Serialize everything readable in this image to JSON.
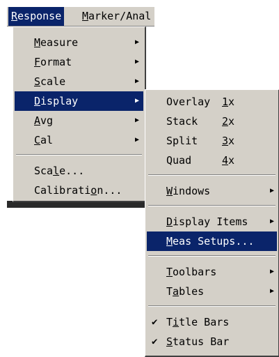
{
  "menubar": {
    "items": [
      {
        "label": "Response",
        "mnemonic": 0,
        "active": true
      },
      {
        "label": "Marker/Anal",
        "mnemonic": 0,
        "active": false
      }
    ]
  },
  "response_menu": {
    "items": [
      {
        "label": "Measure",
        "mnemonic": 0,
        "submenu": true
      },
      {
        "label": "Format",
        "mnemonic": 0,
        "submenu": true
      },
      {
        "label": "Scale",
        "mnemonic": 0,
        "submenu": true
      },
      {
        "label": "Display",
        "mnemonic": 0,
        "submenu": true,
        "highlighted": true
      },
      {
        "label": "Avg",
        "mnemonic": 0,
        "submenu": true
      },
      {
        "label": "Cal",
        "mnemonic": 0,
        "submenu": true
      },
      {
        "separator": true
      },
      {
        "label": "Scale...",
        "mnemonic": 3
      },
      {
        "label": "Calibration...",
        "mnemonic": 9
      }
    ]
  },
  "display_menu": {
    "items": [
      {
        "label": "Overlay",
        "accel": "1x"
      },
      {
        "label": "Stack",
        "accel": "2x"
      },
      {
        "label": "Split",
        "accel": "3x"
      },
      {
        "label": "Quad",
        "accel": "4x"
      },
      {
        "separator": true
      },
      {
        "label": "Windows",
        "mnemonic": 0,
        "submenu": true
      },
      {
        "separator": true
      },
      {
        "label": "Display Items",
        "mnemonic": 0,
        "submenu": true
      },
      {
        "label": "Meas Setups...",
        "mnemonic": 0,
        "highlighted": true
      },
      {
        "separator": true
      },
      {
        "label": "Toolbars",
        "mnemonic": 0,
        "submenu": true
      },
      {
        "label": "Tables",
        "mnemonic": 1,
        "submenu": true
      },
      {
        "separator": true
      },
      {
        "label": "Title Bars",
        "mnemonic": 1,
        "checked": true
      },
      {
        "label": "Status Bar",
        "mnemonic": 0,
        "checked": true
      }
    ]
  },
  "icons": {
    "submenu_arrow": "arrow-right-icon",
    "check": "check-icon"
  },
  "colors": {
    "menu_bg": "#d4d0c8",
    "highlight": "#0a246a",
    "highlight_text": "#ffffff"
  }
}
